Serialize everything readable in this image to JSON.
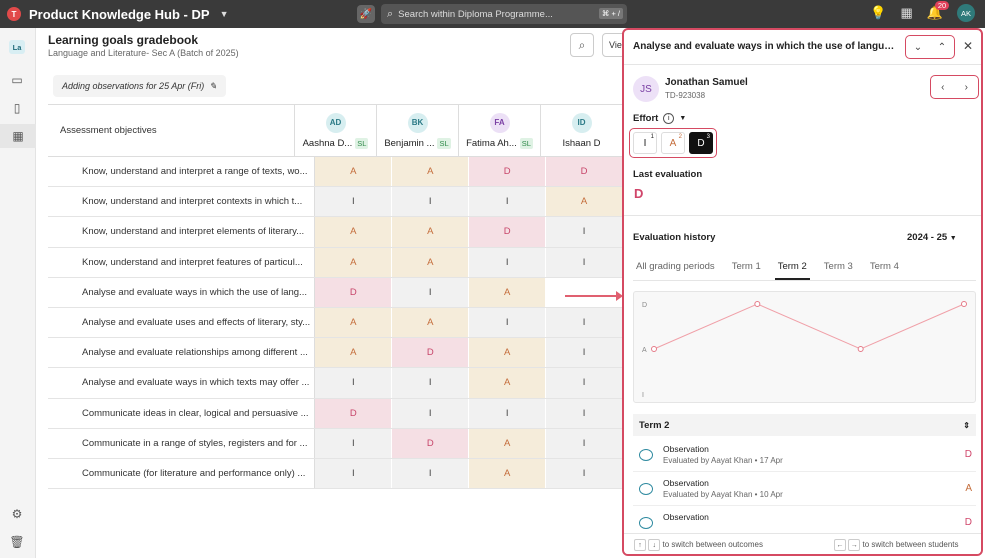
{
  "topbar": {
    "app_title": "Product Knowledge Hub - DP",
    "search_placeholder": "Search within Diploma Programme...",
    "search_shortcut": "⌘ + /",
    "notification_count": "20",
    "user_initials": "AK"
  },
  "nav": {
    "course_badge": "La"
  },
  "page": {
    "title": "Learning goals gradebook",
    "subtitle": "Language and Literature- Sec A (Batch of 2025)",
    "observation_chip": "Adding observations for 25 Apr (Fri)",
    "view_button": "Vie"
  },
  "grid": {
    "header_label": "Assessment objectives",
    "students": [
      {
        "initials": "AD",
        "name": "Aashna D...",
        "tag": "SL",
        "color": "#d7eef0",
        "text": "#2a7a86"
      },
      {
        "initials": "BK",
        "name": "Benjamin ...",
        "tag": "SL",
        "color": "#d7eef0",
        "text": "#2a7a86"
      },
      {
        "initials": "FA",
        "name": "Fatima Ah...",
        "tag": "SL",
        "color": "#ece0f6",
        "text": "#7a3fa4"
      },
      {
        "initials": "ID",
        "name": "Ishaan D",
        "tag": "",
        "color": "#d7eef0",
        "text": "#2a7a86"
      }
    ],
    "rows": [
      {
        "objective": "Know, understand and interpret a range of texts, wo...",
        "grades": [
          "A",
          "A",
          "D",
          "D"
        ]
      },
      {
        "objective": "Know, understand and interpret contexts in which t...",
        "grades": [
          "I",
          "I",
          "I",
          "A"
        ]
      },
      {
        "objective": "Know, understand and interpret elements of literary...",
        "grades": [
          "A",
          "A",
          "D",
          "I"
        ]
      },
      {
        "objective": "Know, understand and interpret features of particul...",
        "grades": [
          "A",
          "A",
          "I",
          "I"
        ]
      },
      {
        "objective": "Analyse and evaluate ways in which the use of lang...",
        "grades": [
          "D",
          "I",
          "A",
          ""
        ]
      },
      {
        "objective": "Analyse and evaluate uses and effects of literary, sty...",
        "grades": [
          "A",
          "A",
          "I",
          "I"
        ]
      },
      {
        "objective": "Analyse and evaluate relationships among different ...",
        "grades": [
          "A",
          "D",
          "A",
          "I"
        ]
      },
      {
        "objective": "Analyse and evaluate ways in which texts may offer ...",
        "grades": [
          "I",
          "I",
          "A",
          "I"
        ]
      },
      {
        "objective": "Communicate ideas in clear, logical and persuasive ...",
        "grades": [
          "D",
          "I",
          "I",
          "I"
        ]
      },
      {
        "objective": "Communicate in a range of styles, registers and for ...",
        "grades": [
          "I",
          "D",
          "A",
          "I"
        ]
      },
      {
        "objective": "Communicate (for literature and performance only) ...",
        "grades": [
          "I",
          "I",
          "A",
          "I"
        ]
      }
    ]
  },
  "panel": {
    "title": "Analyse and evaluate ways in which the use of language...",
    "student_initials": "JS",
    "student_name": "Jonathan Samuel",
    "student_id": "TD-923038",
    "effort_label": "Effort",
    "effort_options": [
      {
        "label": "I",
        "key": "1"
      },
      {
        "label": "A",
        "key": "2"
      },
      {
        "label": "D",
        "key": "3"
      }
    ],
    "last_eval_label": "Last evaluation",
    "last_eval_value": "D",
    "history_label": "Evaluation history",
    "year": "2024 - 25",
    "tabs": [
      "All grading periods",
      "Term 1",
      "Term 2",
      "Term 3",
      "Term 4"
    ],
    "active_tab": "Term 2",
    "term_section": "Term 2",
    "observations": [
      {
        "title": "Observation",
        "meta": "Evaluated by Aayat Khan",
        "date": "17 Apr",
        "grade": "D"
      },
      {
        "title": "Observation",
        "meta": "Evaluated by Aayat Khan",
        "date": "10 Apr",
        "grade": "A"
      },
      {
        "title": "Observation",
        "meta": "",
        "date": "",
        "grade": "D"
      }
    ],
    "footer_left": "to switch between outcomes",
    "footer_right": "to switch between students"
  },
  "chart_data": {
    "type": "line",
    "y_categories": [
      "I",
      "A",
      "D"
    ],
    "values": [
      "A",
      "D",
      "A",
      "D"
    ],
    "colors": {
      "line": "#f0a0a8",
      "point": "#e57a88"
    }
  }
}
